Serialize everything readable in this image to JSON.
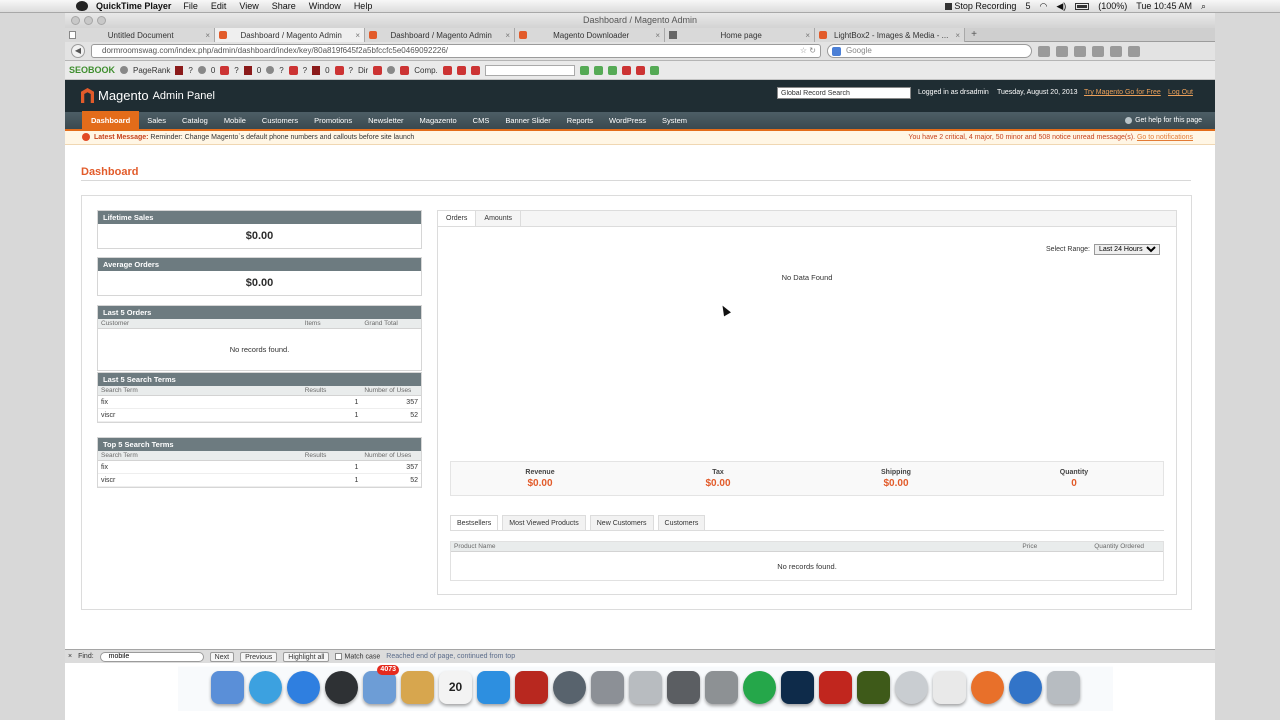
{
  "menubar": {
    "app": "QuickTime Player",
    "items": [
      "File",
      "Edit",
      "View",
      "Share",
      "Window",
      "Help"
    ],
    "stop_recording": "Stop Recording",
    "count": "5",
    "battery": "(100%)",
    "clock": "Tue 10:45 AM"
  },
  "window": {
    "title": "Dashboard / Magento Admin"
  },
  "tabs": [
    {
      "label": "Untitled Document",
      "icon": "document-icon"
    },
    {
      "label": "Dashboard / Magento Admin",
      "icon": "magento-icon",
      "active": true
    },
    {
      "label": "Dashboard / Magento Admin",
      "icon": "magento-icon"
    },
    {
      "label": "Magento Downloader",
      "icon": "magento-icon"
    },
    {
      "label": "Home page",
      "icon": "page-icon"
    },
    {
      "label": "LightBox2 - Images & Media - ...",
      "icon": "magento-icon"
    }
  ],
  "nav": {
    "url": "dormroomswag.com/index.php/admin/dashboard/index/key/80a819f645f2a5bfccfc5e0469092226/",
    "search_placeholder": "Google"
  },
  "seobar": {
    "logo": "SEOBOOK",
    "pagerank": "PageRank",
    "items": [
      "?",
      "0",
      "?",
      "0",
      "?",
      "?",
      "0",
      "?",
      "?",
      "Dir",
      "Comp."
    ]
  },
  "magento": {
    "logo_text": "Magento",
    "logo_sub": "Admin Panel",
    "global_search": "Global Record Search",
    "logged_in": "Logged in as drsadmin",
    "date": "Tuesday, August 20, 2013",
    "try_link": "Try Magento Go for Free",
    "logout": "Log Out",
    "menu": [
      "Dashboard",
      "Sales",
      "Catalog",
      "Mobile",
      "Customers",
      "Promotions",
      "Newsletter",
      "Magazento",
      "CMS",
      "Banner Slider",
      "Reports",
      "WordPress",
      "System"
    ],
    "help": "Get help for this page",
    "message": {
      "label": "Latest Message:",
      "text": "Reminder: Change Magento`s default phone numbers and callouts before site launch",
      "summary": "You have 2 critical, 4 major, 50 minor and 508 notice unread message(s).",
      "link": "Go to notifications"
    },
    "page_title": "Dashboard"
  },
  "dashboard": {
    "lifetime_sales": {
      "label": "Lifetime Sales",
      "value": "$0.00"
    },
    "average_orders": {
      "label": "Average Orders",
      "value": "$0.00"
    },
    "last_orders": {
      "label": "Last 5 Orders",
      "columns": [
        "Customer",
        "Items",
        "Grand Total"
      ],
      "empty": "No records found."
    },
    "last_search": {
      "label": "Last 5 Search Terms",
      "columns": [
        "Search Term",
        "Results",
        "Number of Uses"
      ],
      "rows": [
        [
          "fix",
          "1",
          "357"
        ],
        [
          "viscr",
          "1",
          "52"
        ]
      ]
    },
    "top_search": {
      "label": "Top 5 Search Terms",
      "columns": [
        "Search Term",
        "Results",
        "Number of Uses"
      ],
      "rows": [
        [
          "fix",
          "1",
          "357"
        ],
        [
          "viscr",
          "1",
          "52"
        ]
      ]
    },
    "chart_tabs": [
      "Orders",
      "Amounts"
    ],
    "range_label": "Select Range:",
    "range_value": "Last 24 Hours",
    "no_data": "No Data Found",
    "totals": [
      {
        "label": "Revenue",
        "value": "$0.00"
      },
      {
        "label": "Tax",
        "value": "$0.00"
      },
      {
        "label": "Shipping",
        "value": "$0.00"
      },
      {
        "label": "Quantity",
        "value": "0"
      }
    ],
    "bottom_tabs": [
      "Bestsellers",
      "Most Viewed Products",
      "New Customers",
      "Customers"
    ],
    "bottom_columns": [
      "Product Name",
      "Price",
      "Quantity Ordered"
    ],
    "bottom_empty": "No records found."
  },
  "findbar": {
    "label": "Find:",
    "value": "mobile",
    "next": "Next",
    "previous": "Previous",
    "highlight": "Highlight all",
    "match_case": "Match case",
    "status": "Reached end of page, continued from top"
  },
  "dock": {
    "mail_badge": "4073",
    "calendar_day": "20"
  },
  "colors": {
    "accent": "#e25b2a",
    "header": "#1f2d33",
    "nav": "#3a494f"
  }
}
